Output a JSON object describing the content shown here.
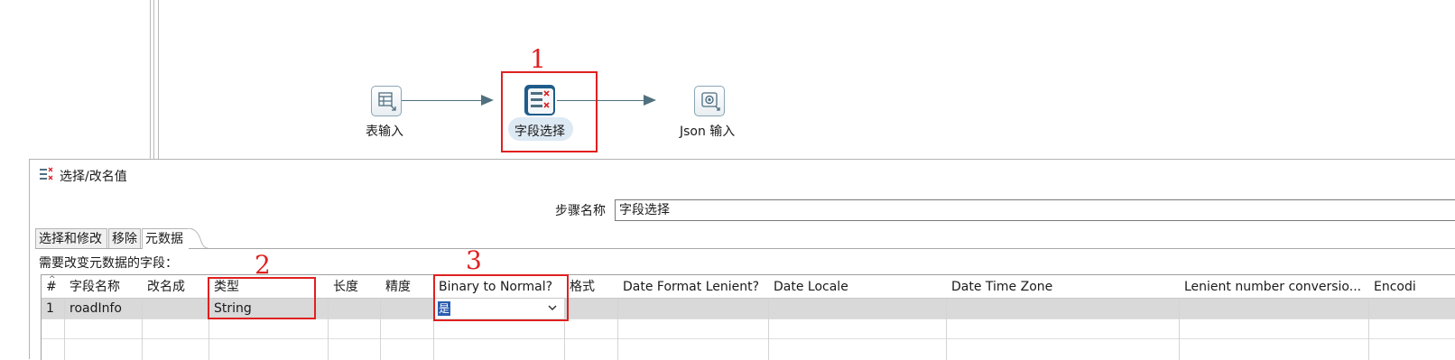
{
  "canvas": {
    "steps": [
      {
        "label": "表输入",
        "icon": "table-input-icon"
      },
      {
        "label": "字段选择",
        "icon": "select-values-icon",
        "selected": true
      },
      {
        "label": "Json 输入",
        "icon": "json-input-icon"
      }
    ],
    "annotations": [
      "1",
      "2",
      "3"
    ]
  },
  "dialog": {
    "title": "选择/改名值",
    "step_name_label": "步骤名称",
    "step_name_value": "字段选择",
    "tabs": [
      {
        "label": "选择和修改",
        "active": false
      },
      {
        "label": "移除",
        "active": false
      },
      {
        "label": "元数据",
        "active": true
      }
    ],
    "section_label": "需要改变元数据的字段：",
    "table": {
      "columns": [
        "#",
        "字段名称",
        "改名成",
        "类型",
        "长度",
        "精度",
        "Binary to Normal?",
        "格式",
        "Date Format Lenient?",
        "Date Locale",
        "Date Time Zone",
        "Lenient number conversio...",
        "Encodi"
      ],
      "rows": [
        {
          "num": "1",
          "field_name": "roadInfo",
          "rename": "",
          "type": "String",
          "length": "",
          "precision": "",
          "binary_to_normal": "是",
          "format": ""
        }
      ]
    }
  },
  "colors": {
    "accent": "#e02020",
    "selection": "#2a5db0",
    "step_active": "#1f5c8b"
  }
}
